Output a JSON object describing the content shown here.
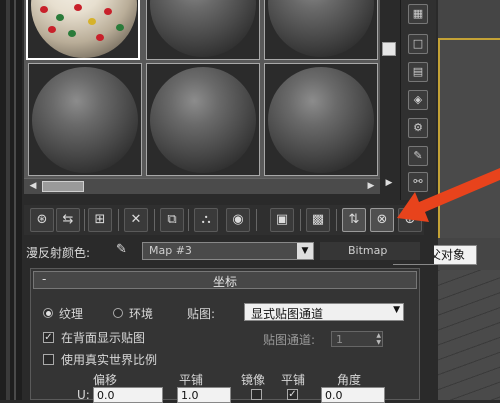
{
  "material_editor": {
    "slots": [
      "textured",
      "default",
      "default",
      "default",
      "default",
      "default"
    ],
    "diffuse": {
      "label": "漫反射颜色:",
      "map_name": "Map #3",
      "map_type": "Bitmap"
    },
    "tooltip": "转到父对象",
    "rollout": {
      "title": "坐标",
      "collapse_symbol": "-",
      "texture_label": "纹理",
      "environ_label": "环境",
      "mapping_label": "贴图:",
      "mapping_value": "显式贴图通道",
      "show_back_label": "在背面显示贴图",
      "map_channel_label": "贴图通道:",
      "map_channel_value": "1",
      "real_world_label": "使用真实世界比例",
      "offset_label": "偏移",
      "tiling_label": "平铺",
      "mirror_label": "镜像",
      "tile_label": "平铺",
      "angle_label": "角度",
      "u_label": "U:",
      "u_offset": "0.0",
      "u_tiling": "1.0",
      "u_angle": "0.0"
    },
    "colors": {
      "background": "#2a2a2a",
      "accent_arrow": "#e8431c",
      "viewport_highlight": "#c4a236"
    }
  }
}
